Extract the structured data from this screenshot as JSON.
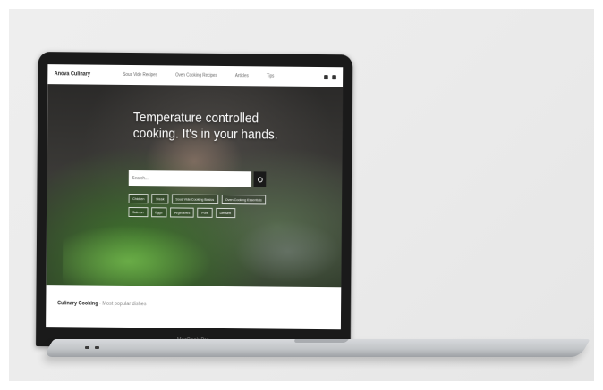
{
  "site": {
    "logo": "Anova Culinary",
    "nav_links": [
      "Sous Vide Recipes",
      "Oven Cooking Recipes",
      "Articles",
      "Tips"
    ],
    "headline": "Temperature controlled cooking. It's in your hands.",
    "search": {
      "placeholder": "Search...",
      "value": ""
    },
    "chips": [
      "Chicken",
      "Steak",
      "Sous Vide Cooking Basics",
      "Oven Cooking Essentials",
      "Salmon",
      "Eggs",
      "Vegetables",
      "Pork",
      "Dessert"
    ],
    "below_title": "Culinary Cooking",
    "below_sub": "Most popular dishes"
  },
  "device": {
    "brand": "MacBook Pro"
  },
  "colors": {
    "bezel": "#1a1a1a",
    "search_button": "#1a1a1a",
    "background": "#ebebeb"
  }
}
